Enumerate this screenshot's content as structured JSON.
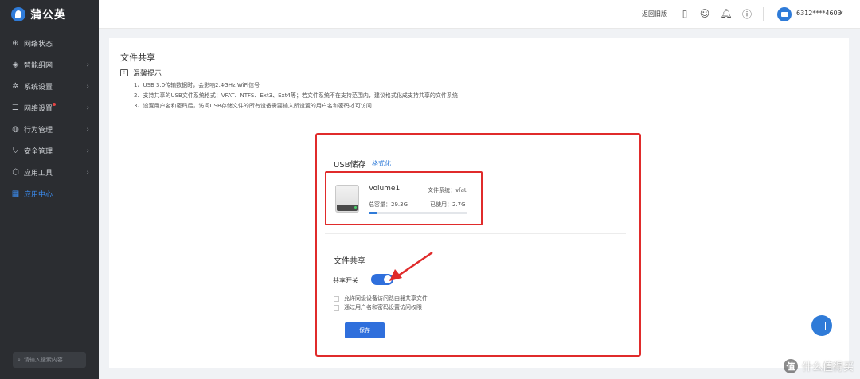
{
  "app": {
    "logo_text": "蒲公英"
  },
  "sidebar": {
    "items": [
      {
        "label": "网络状态",
        "icon": "globe-icon"
      },
      {
        "label": "智能组网",
        "icon": "network-icon"
      },
      {
        "label": "系统设置",
        "icon": "gear-icon"
      },
      {
        "label": "网络设置",
        "icon": "sliders-icon"
      },
      {
        "label": "行为管理",
        "icon": "behavior-icon"
      },
      {
        "label": "安全管理",
        "icon": "shield-icon"
      },
      {
        "label": "应用工具",
        "icon": "tool-icon"
      },
      {
        "label": "应用中心",
        "icon": "grid-icon"
      }
    ],
    "search_placeholder": "请输入搜索内容"
  },
  "topbar": {
    "back_link": "返回旧版",
    "user_id": "6312****4603"
  },
  "page": {
    "title": "文件共享",
    "tips_title": "温馨提示",
    "tips": [
      "1、USB 3.0传输数据时，会影响2.4GHz WiFi信号",
      "2、支持共享的USB文件系统格式：VFAT、NTFS、Ext3、Ext4等；若文件系统不在支持范围内，建议格式化成支持共享的文件系统",
      "3、设置用户名和密码后，访问USB存储文件的所有设备需要输入所设置的用户名和密码才可访问"
    ]
  },
  "usb": {
    "title": "USB储存",
    "format_link": "格式化",
    "volume_name": "Volume1",
    "fs_label": "文件系统：vfat",
    "total_label": "总容量：29.3G",
    "used_label": "已使用：2.7G",
    "used_fraction": 0.092
  },
  "share": {
    "title": "文件共享",
    "switch_label": "共享开关",
    "switch_on": true,
    "options": [
      "允许同级设备访问路由器共享文件",
      "通过用户名和密码设置访问权限"
    ],
    "save_label": "保存"
  },
  "watermark": {
    "badge": "值",
    "text": "什么值得买"
  },
  "colors": {
    "accent": "#2f7bd8",
    "highlight_border": "#e02b2b",
    "sidebar_bg": "#2b2d31"
  }
}
